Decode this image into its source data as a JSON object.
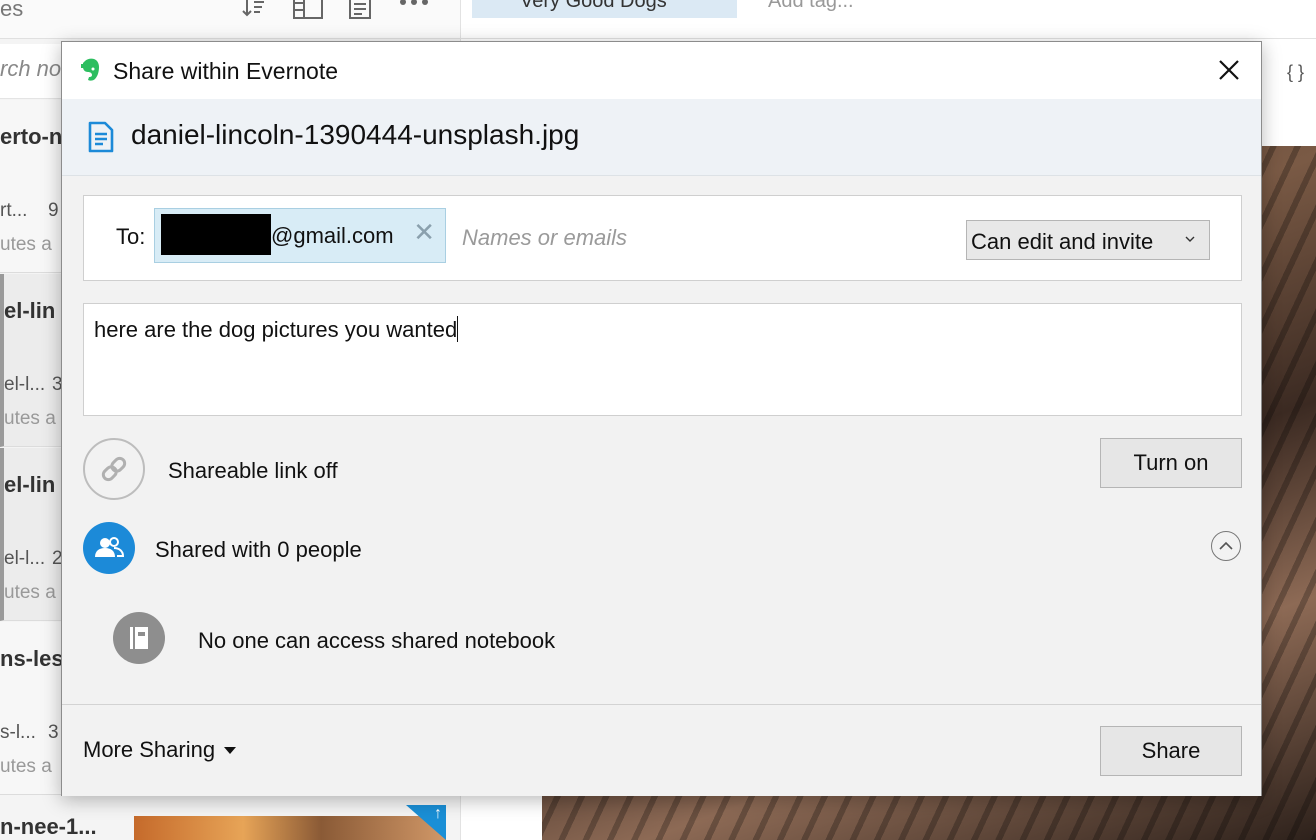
{
  "background": {
    "toolbar_partial_text": "es",
    "search_partial": "rch no",
    "notes": [
      {
        "title": "erto-n",
        "snippet": "rt...",
        "count": "9",
        "meta": "utes a"
      },
      {
        "title": "el-lin",
        "snippet": "el-l...",
        "count": "3",
        "meta": "utes a"
      },
      {
        "title": "el-lin",
        "snippet": "el-l...",
        "count": "2",
        "meta": "utes a"
      },
      {
        "title": "ns-les",
        "snippet": "s-l...",
        "count": "3",
        "meta": "utes a"
      }
    ],
    "last_note_title": "n-nee-1...",
    "notebook_tag": "Very Good Dogs",
    "add_tag": "Add tag...",
    "code_icon": "{ }"
  },
  "dialog": {
    "title": "Share within Evernote",
    "logo_icon": "evernote-logo",
    "close_icon": "close-icon",
    "note_title": "daniel-lincoln-1390444-unsplash.jpg",
    "to_label": "To:",
    "recipient_email_suffix": "@gmail.com",
    "recipient_remove": "✕",
    "names_placeholder": "Names or emails",
    "permission": "Can edit and invite",
    "message": "here are the dog pictures you wanted",
    "shareable_link_label": "Shareable link off",
    "turn_on_button": "Turn on",
    "shared_with_label": "Shared with 0 people",
    "no_access_label": "No one can access shared notebook",
    "more_sharing": "More Sharing",
    "share_button": "Share"
  },
  "colors": {
    "accent_blue": "#1c8ad8",
    "chip_bg": "#d8ecf6",
    "evernote_green": "#2dbe60"
  }
}
